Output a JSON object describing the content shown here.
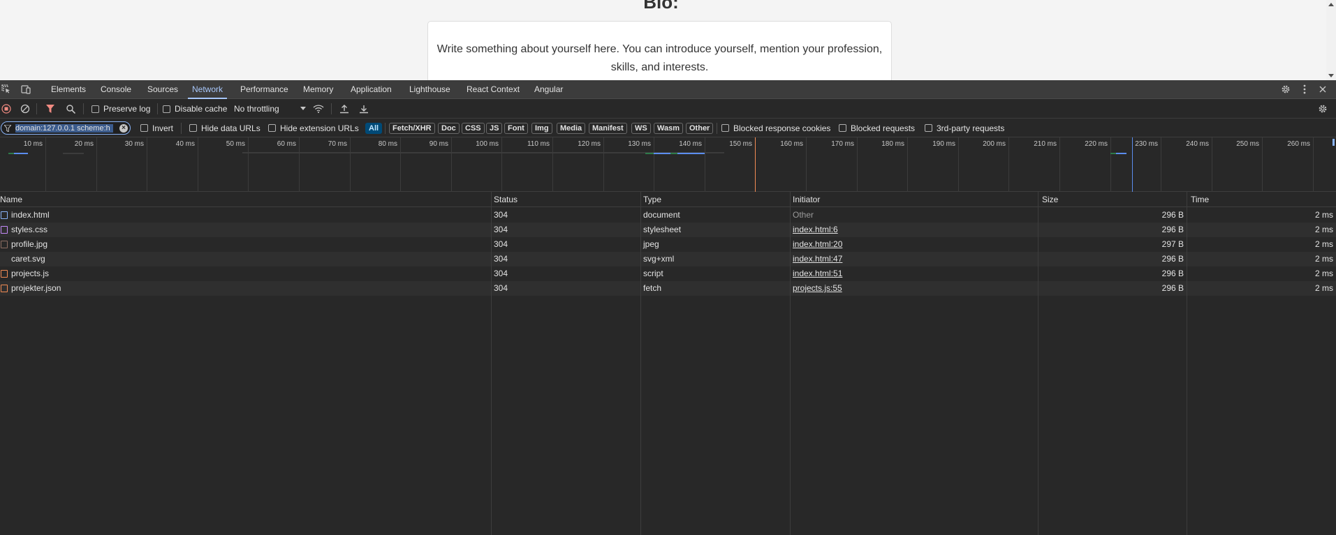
{
  "page": {
    "heading": "Bio:",
    "bio_text": "Write something about yourself here. You can introduce yourself, mention your profession, skills, and interests."
  },
  "devtools": {
    "tabs": [
      "Elements",
      "Console",
      "Sources",
      "Network",
      "Performance",
      "Memory",
      "Application",
      "Lighthouse",
      "React Context",
      "Angular"
    ],
    "active_tab": "Network",
    "toolbar": {
      "preserve_log": "Preserve log",
      "disable_cache": "Disable cache",
      "throttling": "No throttling"
    },
    "filter": {
      "value": "domain:127.0.0.1 scheme:h",
      "invert": "Invert",
      "hide_data_urls": "Hide data URLs",
      "hide_extension_urls": "Hide extension URLs",
      "types": [
        "All",
        "Fetch/XHR",
        "Doc",
        "CSS",
        "JS",
        "Font",
        "Img",
        "Media",
        "Manifest",
        "WS",
        "Wasm",
        "Other"
      ],
      "active_type": "All",
      "blocked_response_cookies": "Blocked response cookies",
      "blocked_requests": "Blocked requests",
      "third_party": "3rd-party requests"
    },
    "timeline_ticks": [
      "10 ms",
      "20 ms",
      "30 ms",
      "40 ms",
      "50 ms",
      "60 ms",
      "70 ms",
      "80 ms",
      "90 ms",
      "100 ms",
      "110 ms",
      "120 ms",
      "130 ms",
      "140 ms",
      "150 ms",
      "160 ms",
      "170 ms",
      "180 ms",
      "190 ms",
      "200 ms",
      "210 ms",
      "220 ms",
      "230 ms",
      "240 ms",
      "250 ms",
      "260 ms"
    ],
    "columns": [
      "Name",
      "Status",
      "Type",
      "Initiator",
      "Size",
      "Time"
    ],
    "requests": [
      {
        "name": "index.html",
        "status": "304",
        "type": "document",
        "initiator": "Other",
        "size": "296 B",
        "time": "2 ms",
        "icon": "document-icon",
        "color": "#8ab4f8",
        "initiator_link": false
      },
      {
        "name": "styles.css",
        "status": "304",
        "type": "stylesheet",
        "initiator": "index.html:6",
        "size": "296 B",
        "time": "2 ms",
        "icon": "stylesheet-icon",
        "color": "#c58af9",
        "initiator_link": true
      },
      {
        "name": "profile.jpg",
        "status": "304",
        "type": "jpeg",
        "initiator": "index.html:20",
        "size": "297 B",
        "time": "2 ms",
        "icon": "image-icon",
        "color": "#8d6e63",
        "initiator_link": true
      },
      {
        "name": "caret.svg",
        "status": "304",
        "type": "svg+xml",
        "initiator": "index.html:47",
        "size": "296 B",
        "time": "2 ms",
        "icon": "svg-icon",
        "color": "#282828",
        "initiator_link": true
      },
      {
        "name": "projects.js",
        "status": "304",
        "type": "script",
        "initiator": "index.html:51",
        "size": "296 B",
        "time": "2 ms",
        "icon": "script-icon",
        "color": "#f28b54",
        "initiator_link": true
      },
      {
        "name": "projekter.json",
        "status": "304",
        "type": "fetch",
        "initiator": "projects.js:55",
        "size": "296 B",
        "time": "2 ms",
        "icon": "fetch-icon",
        "color": "#f28b54",
        "initiator_link": true
      }
    ]
  }
}
